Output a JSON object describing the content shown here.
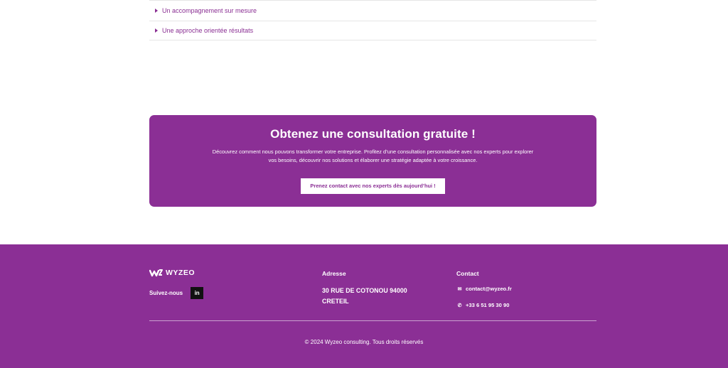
{
  "accordion": {
    "items": [
      {
        "label": "Un accompagnement sur mesure"
      },
      {
        "label": "Une approche orientée résultats"
      }
    ]
  },
  "cta": {
    "title": "Obtenez une consultation gratuite !",
    "text": "Découvrez comment nous pouvons transformer votre entreprise. Profitez d’une consultation personnalisée avec nos experts pour explorer vos besoins, découvrir nos solutions et élaborer une stratégie adaptée à votre croissance.",
    "button_label": "Prenez contact avec nos experts dès aujourd’hui !"
  },
  "footer": {
    "logo_text": "WYZEO",
    "follow_label": "Suivez-nous",
    "linkedin_label": "in",
    "address_title": "Adresse",
    "address_text": "30 RUE DE COTONOU 94000 CRETEIL",
    "contact_title": "Contact",
    "email": "contact@wyzeo.fr",
    "phone": "+33 6 51 95 30 90",
    "copyright": "© 2024 Wyzeo consulting. Tous droits réservés"
  },
  "colors": {
    "brand": "#8b2f95",
    "text_on_brand": "#ffffff"
  },
  "icons": {
    "accordion_caret": "caret-right-icon",
    "email": "envelope-icon",
    "phone": "phone-icon",
    "social": "linkedin-icon"
  }
}
